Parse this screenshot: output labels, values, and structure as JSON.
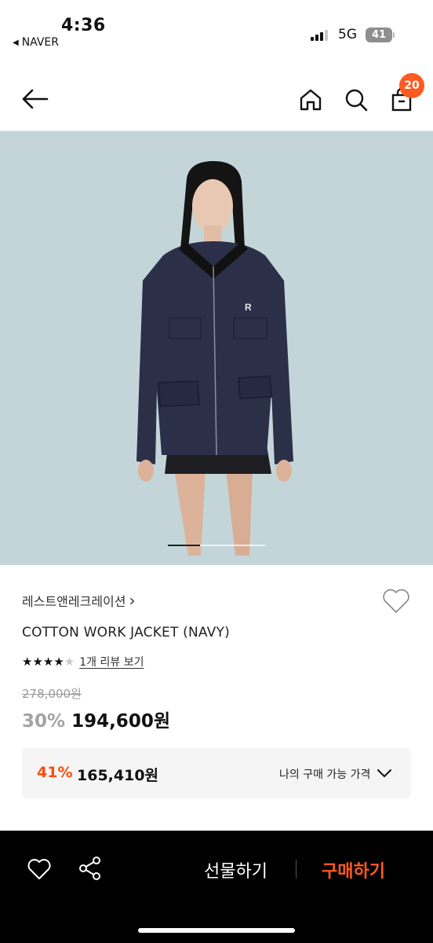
{
  "status_bar": {
    "time": "4:36",
    "back_app": "NAVER",
    "network": "5G",
    "battery": "41"
  },
  "header": {
    "cart_count": "20"
  },
  "product": {
    "brand": "레스트앤레크레이션",
    "brand_chevron": "›",
    "title": "COTTON WORK JACKET (NAVY)",
    "rating_stars": 4,
    "rating_max": 5,
    "review_link": "1개 리뷰 보기",
    "original_price": "278,000원",
    "discount_pct": "30%",
    "sale_price": "194,600원"
  },
  "my_price": {
    "pct": "41%",
    "value": "165,410원",
    "label": "나의 구매 가능 가격"
  },
  "gallery": {
    "current_slide_fraction": 0.33
  },
  "bottom_bar": {
    "gift_label": "선물하기",
    "buy_label": "구매하기"
  },
  "colors": {
    "accent": "#ff5a1f",
    "image_bg": "#c3d5d9",
    "jacket": "#2b2f48"
  }
}
